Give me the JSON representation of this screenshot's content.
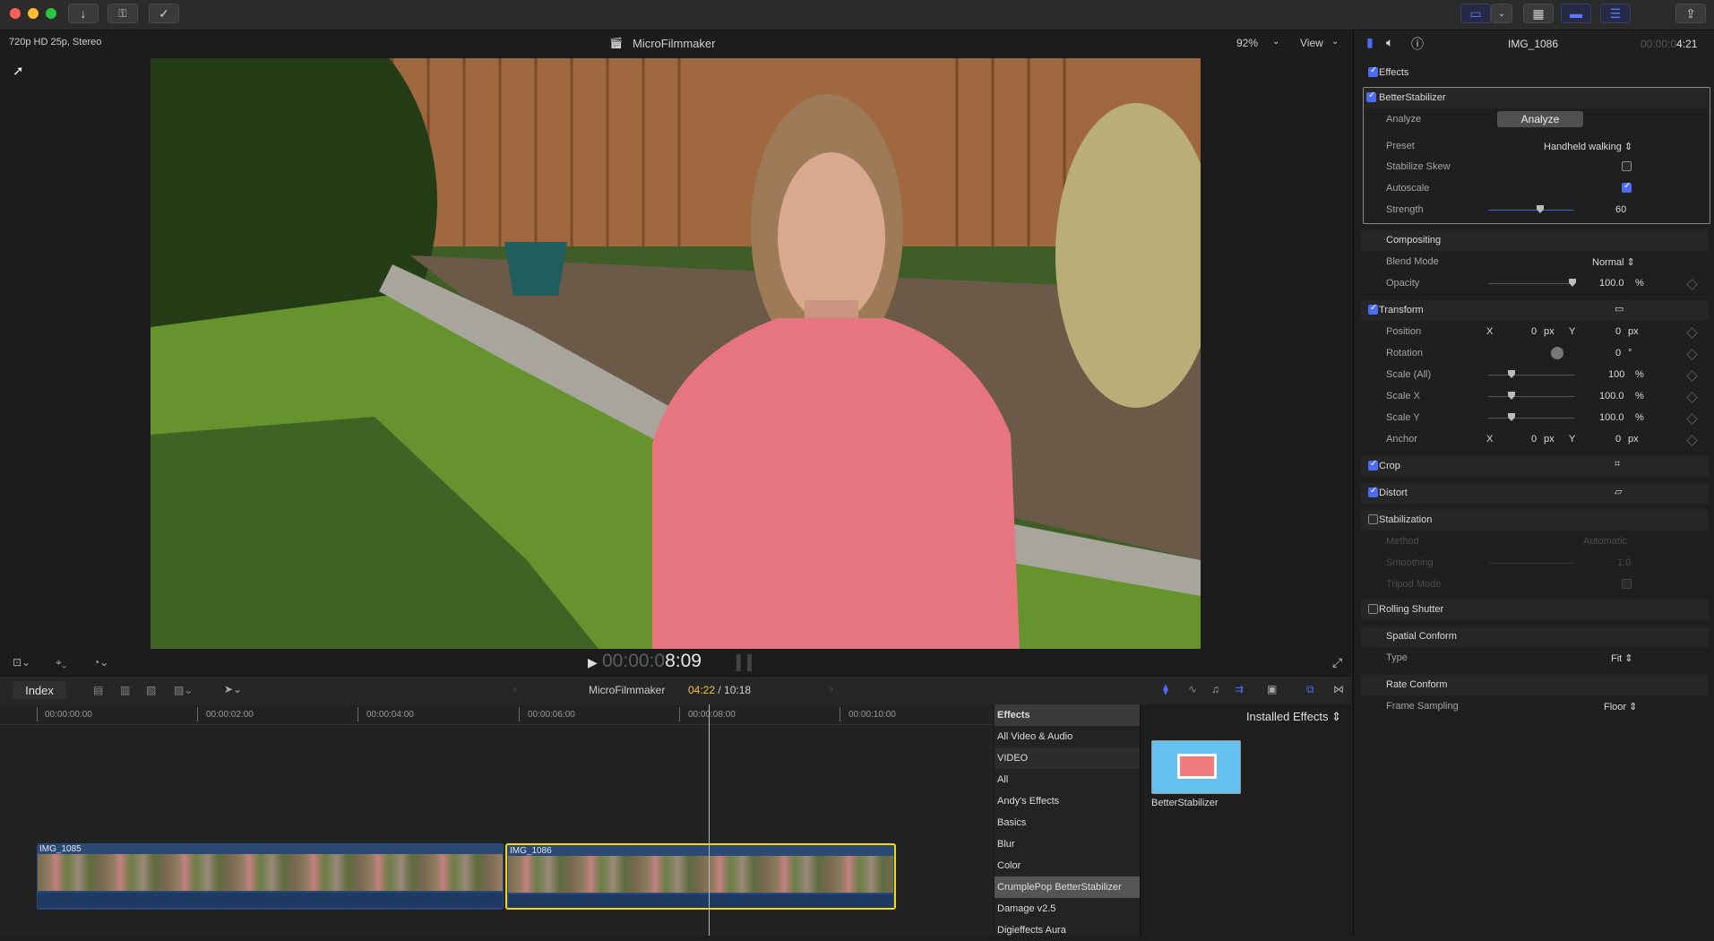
{
  "window": {
    "project_name": "MicroFilmmaker"
  },
  "viewer": {
    "format": "720p HD 25p, Stereo",
    "zoom": "92%",
    "view_label": "View",
    "timecode_dim": "00:00:0",
    "timecode_lit": "8:09"
  },
  "timeline_header": {
    "index_label": "Index",
    "project": "MicroFilmmaker",
    "position": "04:22",
    "separator": " / ",
    "duration": "10:18"
  },
  "ruler": [
    "00:00:00:00",
    "00:00:02:00",
    "00:00:04:00",
    "00:00:06:00",
    "00:00:08:00",
    "00:00:10:00"
  ],
  "clips": [
    {
      "name": "IMG_1085"
    },
    {
      "name": "IMG_1086"
    }
  ],
  "effects_browser": {
    "header": "Effects",
    "installed": "Installed Effects",
    "items": [
      "All Video & Audio",
      "VIDEO",
      "All",
      "Andy's Effects",
      "Basics",
      "Blur",
      "Color",
      "CrumplePop BetterStabilizer",
      "Damage v2.5",
      "Digieffects Aura"
    ],
    "selected": "CrumplePop BetterStabilizer",
    "thumb_label": "BetterStabilizer"
  },
  "inspector": {
    "clip_name": "IMG_1086",
    "timecode_dim": "00:00:0",
    "timecode_lit": "4:21",
    "effects_label": "Effects",
    "stabilizer": {
      "title": "BetterStabilizer",
      "analyze_label": "Analyze",
      "analyze_button": "Analyze",
      "preset_label": "Preset",
      "preset_value": "Handheld walking",
      "skew_label": "Stabilize Skew",
      "skew_checked": false,
      "autoscale_label": "Autoscale",
      "autoscale_checked": true,
      "strength_label": "Strength",
      "strength_value": "60"
    },
    "compositing": {
      "title": "Compositing",
      "blend_label": "Blend Mode",
      "blend_value": "Normal",
      "opacity_label": "Opacity",
      "opacity_value": "100.0",
      "opacity_unit": "%"
    },
    "transform": {
      "title": "Transform",
      "position_label": "Position",
      "x_label": "X",
      "y_label": "Y",
      "pos_x": "0",
      "pos_y": "0",
      "px_unit": "px",
      "rotation_label": "Rotation",
      "rotation_value": "0",
      "rotation_unit": "°",
      "scale_all_label": "Scale (All)",
      "scale_all_value": "100",
      "scale_x_label": "Scale X",
      "scale_x_value": "100.0",
      "scale_y_label": "Scale Y",
      "scale_y_value": "100.0",
      "pct_unit": "%",
      "anchor_label": "Anchor",
      "anchor_x": "0",
      "anchor_y": "0"
    },
    "crop_label": "Crop",
    "distort_label": "Distort",
    "stabilization": {
      "title": "Stabilization",
      "method_label": "Method",
      "method_value": "Automatic",
      "smoothing_label": "Smoothing",
      "smoothing_value": "1.0",
      "tripod_label": "Tripod Mode"
    },
    "rolling_shutter_label": "Rolling Shutter",
    "spatial_conform": {
      "title": "Spatial Conform",
      "type_label": "Type",
      "type_value": "Fit"
    },
    "rate_conform": {
      "title": "Rate Conform",
      "frame_label": "Frame Sampling",
      "frame_value": "Floor"
    }
  },
  "colors": {
    "accent": "#4c6cf5",
    "selection": "#f5d60c",
    "clip": "#2a4a75"
  }
}
